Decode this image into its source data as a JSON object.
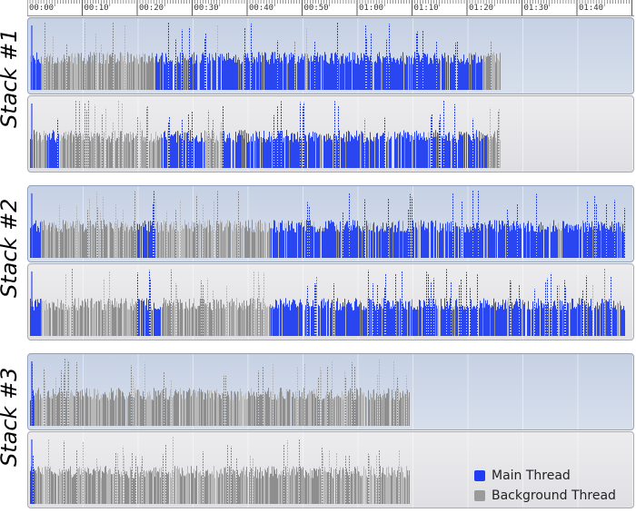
{
  "ruler": {
    "ticks": [
      "00:00",
      "00:10",
      "00:20",
      "00:30",
      "00:40",
      "00:50",
      "01:00",
      "01:10",
      "01:20",
      "01:30",
      "01:40"
    ]
  },
  "stacks": [
    {
      "label": "Stack #1",
      "panels": [
        {
          "state": "selected",
          "end_fraction": 0.78,
          "blue_ranges": [
            [
              0.0,
              0.02
            ],
            [
              0.21,
              0.75
            ]
          ]
        },
        {
          "state": "unselected",
          "end_fraction": 0.78,
          "blue_ranges": [
            [
              0.0,
              0.01
            ],
            [
              0.03,
              0.05
            ],
            [
              0.22,
              0.29
            ],
            [
              0.32,
              0.76
            ]
          ]
        }
      ]
    },
    {
      "label": "Stack #2",
      "panels": [
        {
          "state": "selected",
          "end_fraction": 0.985,
          "blue_ranges": [
            [
              0.0,
              0.02
            ],
            [
              0.18,
              0.21
            ],
            [
              0.4,
              0.99
            ]
          ]
        },
        {
          "state": "unselected",
          "end_fraction": 0.985,
          "blue_ranges": [
            [
              0.0,
              0.02
            ],
            [
              0.18,
              0.22
            ],
            [
              0.4,
              0.99
            ]
          ]
        }
      ]
    },
    {
      "label": "Stack #3",
      "panels": [
        {
          "state": "selected",
          "end_fraction": 0.63,
          "blue_ranges": [
            [
              0.0,
              0.01
            ]
          ]
        },
        {
          "state": "unselected",
          "end_fraction": 0.63,
          "blue_ranges": [
            [
              0.0,
              0.01
            ]
          ]
        }
      ]
    }
  ],
  "legend": {
    "items": [
      {
        "label": "Main Thread",
        "color": "#1f3df5"
      },
      {
        "label": "Background Thread",
        "color": "#9a9a9a"
      }
    ]
  },
  "colors": {
    "main_thread": "#2a46f0",
    "background_thread": "#8e8e8e",
    "background_thread_light": "#b8b8b8"
  }
}
